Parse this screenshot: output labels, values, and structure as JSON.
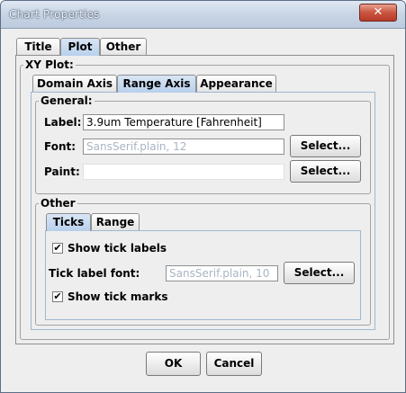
{
  "window": {
    "title": "Chart Properties",
    "close_label": "✕"
  },
  "top_tabs": [
    "Title",
    "Plot",
    "Other"
  ],
  "xy_plot_legend": "XY Plot:",
  "axis_tabs": [
    "Domain Axis",
    "Range Axis",
    "Appearance"
  ],
  "general": {
    "legend": "General:",
    "label_caption": "Label:",
    "label_value": "3.9um Temperature [Fahrenheit]",
    "font_caption": "Font:",
    "font_value": "SansSerif.plain, 12",
    "paint_caption": "Paint:",
    "select_label": "Select..."
  },
  "other": {
    "legend": "Other",
    "tabs": [
      "Ticks",
      "Range"
    ],
    "show_tick_labels": "Show tick labels",
    "show_tick_labels_checked": true,
    "tick_font_caption": "Tick label font:",
    "tick_font_value": "SansSerif.plain, 10",
    "show_tick_marks": "Show tick marks",
    "show_tick_marks_checked": true,
    "select_label": "Select...",
    "check_mark": "✔"
  },
  "buttons": {
    "ok": "OK",
    "cancel": "Cancel"
  },
  "colors": {
    "active_tab": "#b8d0ec",
    "close_button": "#c9553f"
  }
}
